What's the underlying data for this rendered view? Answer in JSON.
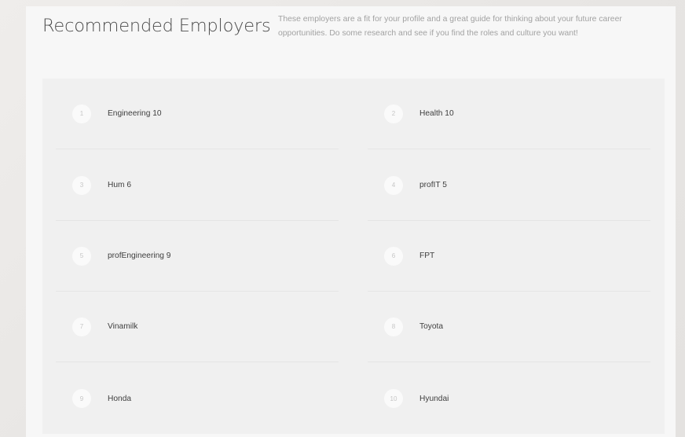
{
  "header": {
    "title": "Recommended Employers",
    "description": "These employers are a fit for your profile and a great guide for thinking about your future career opportunities. Do some research and see if you find the roles and culture you want!"
  },
  "employers": [
    {
      "rank": "1",
      "name": "Engineering 10"
    },
    {
      "rank": "2",
      "name": "Health 10"
    },
    {
      "rank": "3",
      "name": "Hum 6"
    },
    {
      "rank": "4",
      "name": "profIT 5"
    },
    {
      "rank": "5",
      "name": "profEngineering 9"
    },
    {
      "rank": "6",
      "name": "FPT"
    },
    {
      "rank": "7",
      "name": "Vinamilk"
    },
    {
      "rank": "8",
      "name": "Toyota"
    },
    {
      "rank": "9",
      "name": "Honda"
    },
    {
      "rank": "10",
      "name": "Hyundai"
    }
  ]
}
